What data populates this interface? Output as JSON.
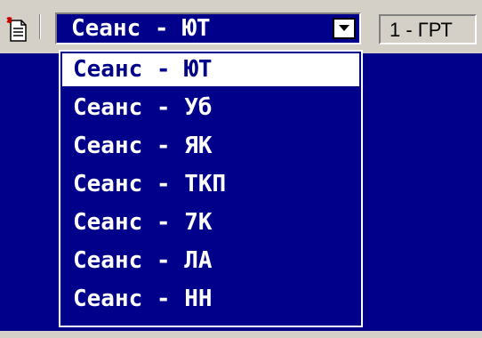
{
  "toolbar": {
    "doc_icon": "new-document-icon",
    "session_select": {
      "value": "Сеанс - ЮТ",
      "options": [
        "Сеанс - ЮТ",
        "Сеанс - Уб",
        "Сеанс - ЯК",
        "Сеанс - ТКП",
        "Сеанс - 7К",
        "Сеанс - ЛА",
        "Сеанс - НН"
      ],
      "selected_index": 0
    },
    "mode_label": "1 - ГРТ"
  },
  "colors": {
    "panel": "#d4d0c8",
    "workspace": "#00008b",
    "text": "#ffffff",
    "highlight": "#ffffff"
  }
}
